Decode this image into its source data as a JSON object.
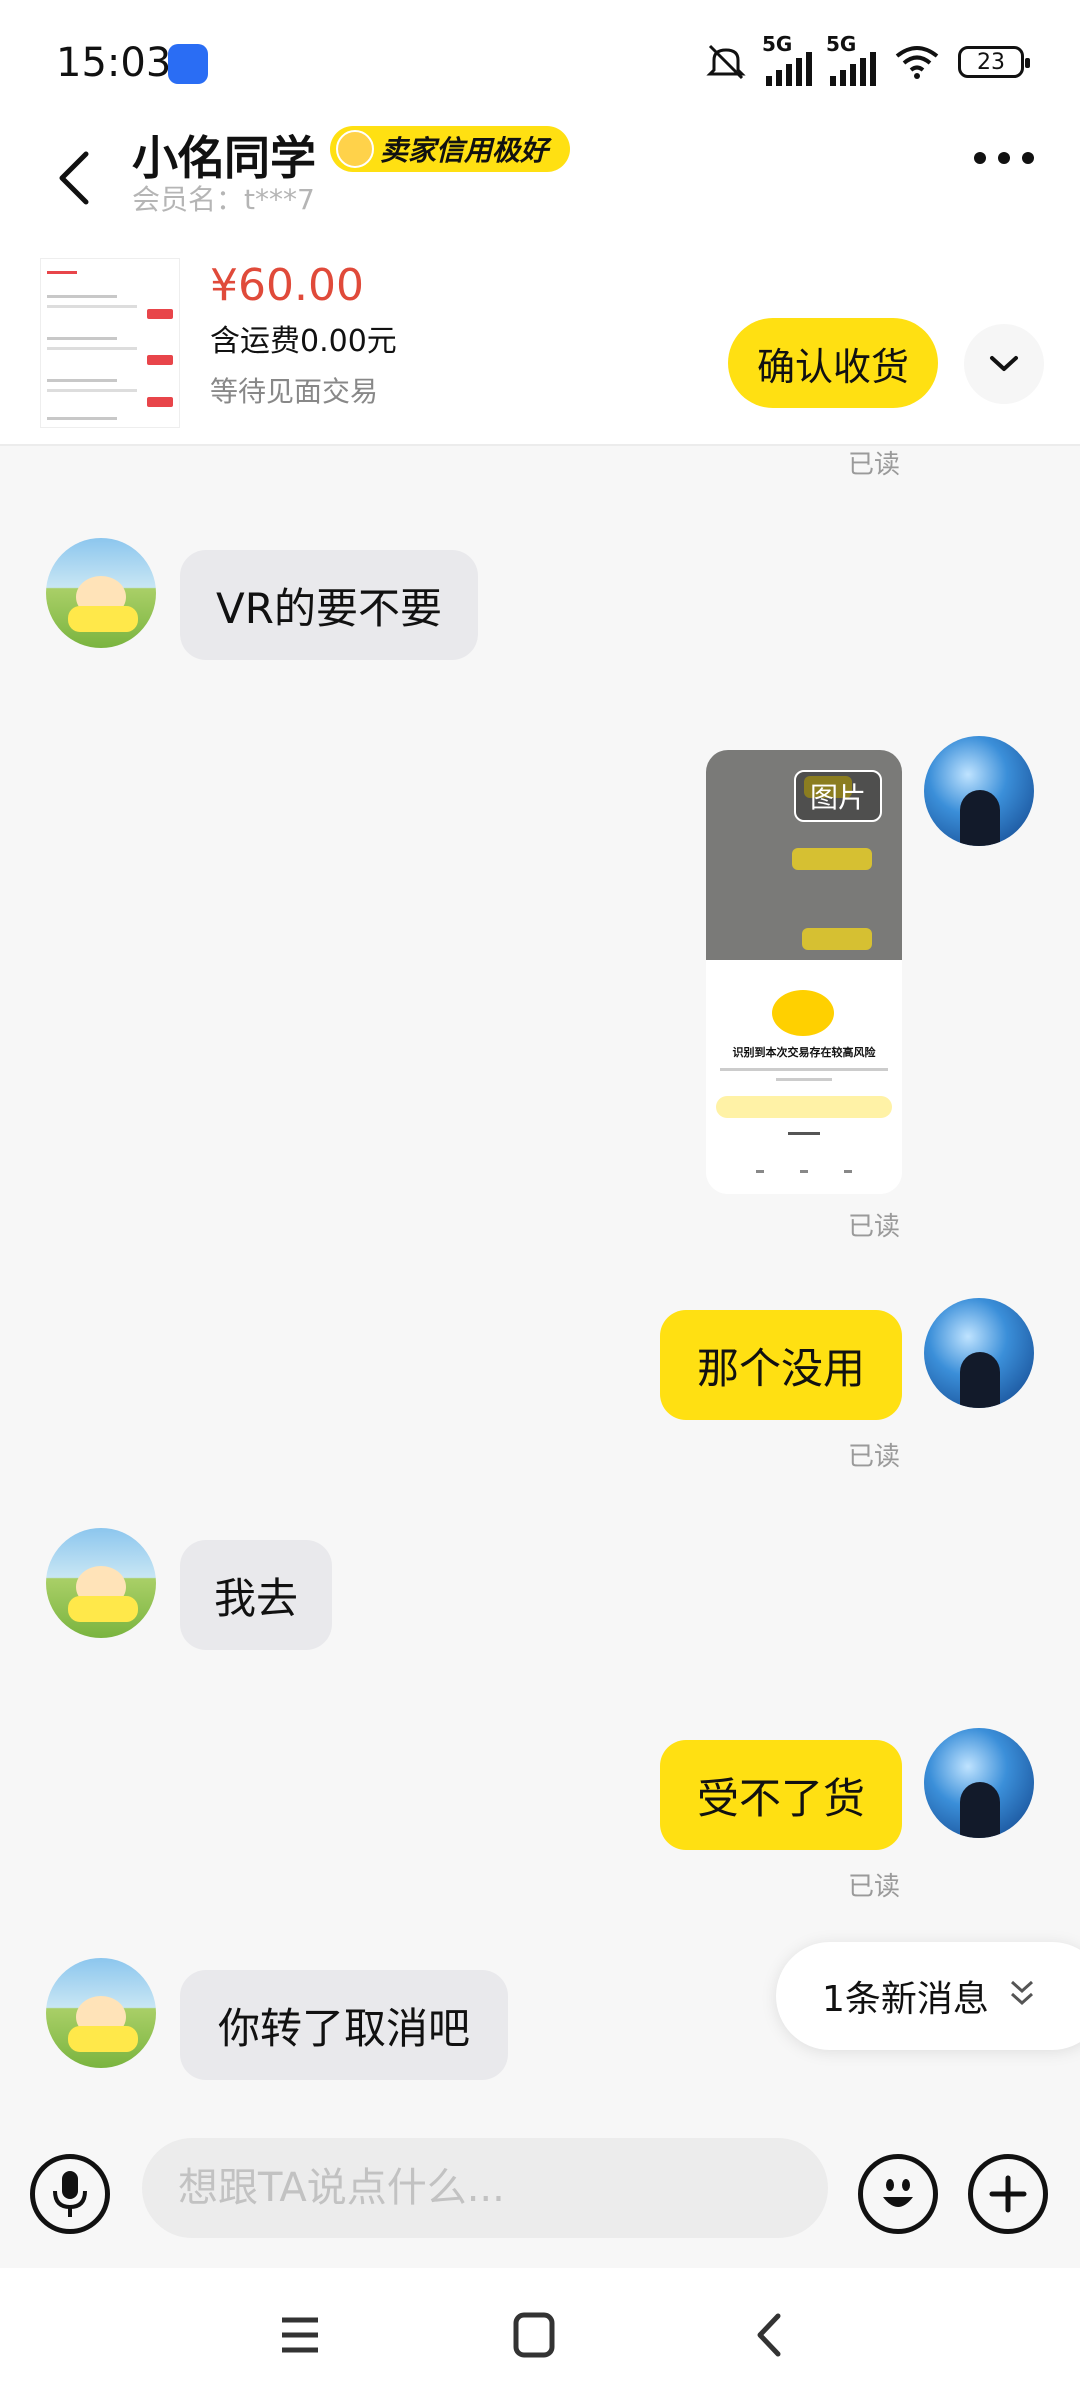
{
  "status_bar": {
    "time": "15:03",
    "network_1": "5G",
    "network_2": "5G",
    "battery": "23",
    "icons": [
      "baidu-app-icon",
      "mute-icon",
      "signal-icon",
      "wifi-icon",
      "battery-icon"
    ]
  },
  "header": {
    "contact_name": "小佲同学",
    "badge": "卖家信用极好",
    "member_label": "会员名：t***7"
  },
  "order": {
    "price": "¥60.00",
    "shipping": "含运费0.00元",
    "status": "等待见面交易",
    "confirm_button": "确认收货"
  },
  "messages": {
    "m1_read": "已读",
    "m2_text": "VR的要不要",
    "m3_image_tag": "图片",
    "m3_read": "已读",
    "m4_text": "那个没用",
    "m4_read": "已读",
    "m5_text": "我去",
    "m6_text": "受不了货",
    "m6_read": "已读",
    "m7_text": "你转了取消吧"
  },
  "image_preview": {
    "warning": "识别到本次交易存在较高风险"
  },
  "new_message_pill": "1条新消息",
  "input": {
    "placeholder": "想跟TA说点什么..."
  },
  "colors": {
    "accent_yellow": "#ffe012",
    "price_red": "#e04a3a",
    "bubble_grey": "#e9e9ec",
    "background": "#f7f7f7"
  }
}
